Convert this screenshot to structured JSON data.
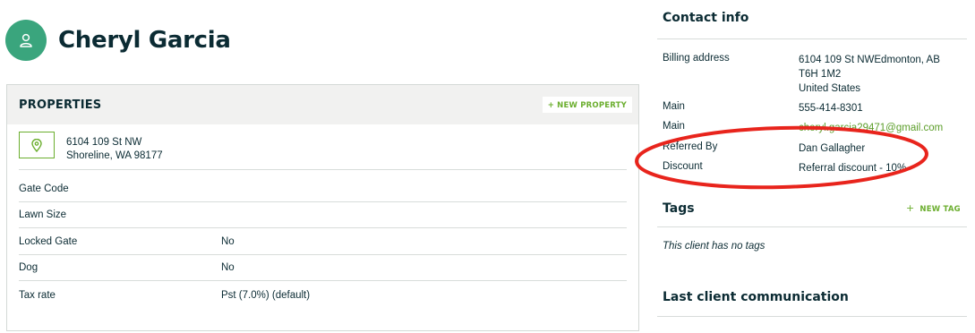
{
  "client": {
    "name": "Cheryl Garcia",
    "avatar_icon": "person-icon"
  },
  "properties": {
    "title": "PROPERTIES",
    "new_property_label": "+ NEW PROPERTY",
    "address": {
      "line1": "6104 109 St NW",
      "line2": "Shoreline, WA 98177"
    },
    "fields": [
      {
        "label": "Gate Code",
        "value": ""
      },
      {
        "label": "Lawn Size",
        "value": ""
      },
      {
        "label": "Locked Gate",
        "value": "No"
      },
      {
        "label": "Dog",
        "value": "No"
      },
      {
        "label": "Tax rate",
        "value": "Pst (7.0%) (default)"
      }
    ]
  },
  "contact_info": {
    "title": "Contact info",
    "billing": {
      "label": "Billing address",
      "line1": "6104 109 St NWEdmonton, AB T6H 1M2",
      "line2": "United States"
    },
    "rows": [
      {
        "label": "Main",
        "value": "555-414-8301"
      },
      {
        "label": "Main",
        "value": "cheryl.garcia29471@gmail.com"
      },
      {
        "label": "Referred By",
        "value": "Dan Gallagher"
      },
      {
        "label": "Discount",
        "value": "Referral discount - 10%"
      }
    ]
  },
  "tags": {
    "title": "Tags",
    "new_tag_label": "NEW TAG",
    "empty_text": "This client has no tags"
  },
  "last_communication": {
    "title": "Last client communication"
  },
  "colors": {
    "accent_green": "#6bae2e",
    "avatar_green": "#3aa57d",
    "annotation_red": "#e8241c"
  }
}
